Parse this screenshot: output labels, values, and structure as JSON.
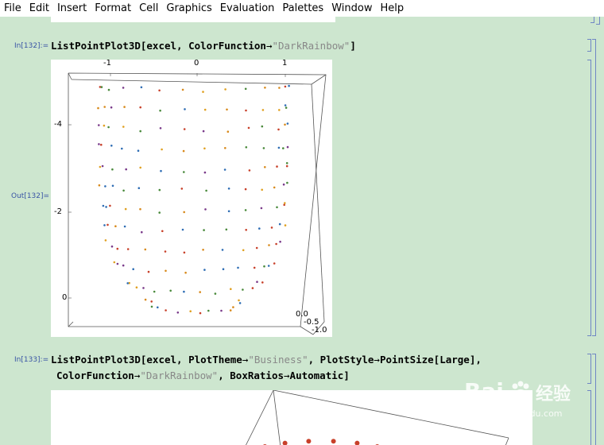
{
  "menubar": {
    "items": [
      "File",
      "Edit",
      "Insert",
      "Format",
      "Cell",
      "Graphics",
      "Evaluation",
      "Palettes",
      "Window",
      "Help"
    ]
  },
  "cells": {
    "in132": {
      "label": "In[132]:=",
      "code": {
        "prefix": "ListPointPlot3D[excel, ColorFunction",
        "arrow": "→",
        "string": "\"DarkRainbow\"",
        "suffix": "]"
      }
    },
    "out132": {
      "label": "Out[132]=",
      "top_ticks": [
        "-1",
        "0",
        "1"
      ],
      "left_ticks": [
        "-4",
        "-2",
        "0"
      ],
      "corner_ticks": [
        "0.0",
        "-0.5",
        "-1.0"
      ]
    },
    "in133": {
      "label": "In[133]:=",
      "line1": {
        "a": "ListPointPlot3D[excel, PlotTheme",
        "arrow1": "→",
        "s1": "\"Business\"",
        "b": ", PlotStyle",
        "arrow2": "→",
        "c": "PointSize[Large],"
      },
      "line2": {
        "a": "ColorFunction",
        "arrow1": "→",
        "s1": "\"DarkRainbow\"",
        "b": ", BoxRatios",
        "arrow2": "→",
        "c": "Automatic]"
      }
    }
  },
  "watermark": {
    "brand": "Bai",
    "cn": "经验",
    "url": "jingyan.baidu.com"
  },
  "colors": {
    "cell_background": "#cde6cf",
    "label_blue": "#3a55a5",
    "bracket_blue": "#6f86c4",
    "point_colors": [
      "#c8402a",
      "#d88a1c",
      "#2e6db4",
      "#4a8a3c",
      "#7a3a8a",
      "#e0a020"
    ]
  }
}
